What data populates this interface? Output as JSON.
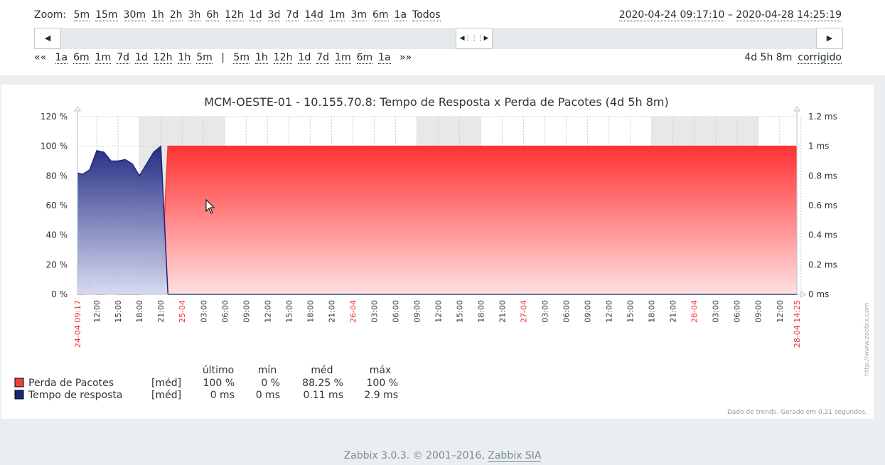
{
  "zoom": {
    "label": "Zoom:",
    "options": [
      "5m",
      "15m",
      "30m",
      "1h",
      "2h",
      "3h",
      "6h",
      "12h",
      "1d",
      "3d",
      "7d",
      "14d",
      "1m",
      "3m",
      "6m",
      "1a",
      "Todos"
    ]
  },
  "period": {
    "from": "2020-04-24 09:17:10",
    "separator": " – ",
    "to": "2020-04-28 14:25:19"
  },
  "scroll": {
    "left_icon": "triangle-left-icon",
    "right_icon": "triangle-right-icon",
    "thumb_icon": "drag-handle-icon",
    "left_glyph": "◀",
    "right_glyph": "▶",
    "thumb_glyph": "◀⋮⋮⋮▶"
  },
  "nav": {
    "back_all": "««",
    "back": [
      "1a",
      "6m",
      "1m",
      "7d",
      "1d",
      "12h",
      "1h",
      "5m"
    ],
    "separator": "|",
    "forward": [
      "5m",
      "1h",
      "12h",
      "1d",
      "7d",
      "1m",
      "6m",
      "1a"
    ],
    "forward_all": "»»"
  },
  "fixed": {
    "duration": "4d 5h 8m",
    "mode_link": "corrigido"
  },
  "graph": {
    "title": "MCM-OESTE-01 - 10.155.70.8: Tempo de Resposta x Perda de Pacotes (4d 5h 8m)",
    "left_ticks": [
      "120 %",
      "100 %",
      "80 %",
      "60 %",
      "40 %",
      "20 %",
      "0 %"
    ],
    "right_ticks": [
      "1.2 ms",
      "1 ms",
      "0.8 ms",
      "0.6 ms",
      "0.4 ms",
      "0.2 ms",
      "0 ms"
    ],
    "x_labels": [
      {
        "t": "24-04 09:17",
        "red": true
      },
      {
        "t": "12:00"
      },
      {
        "t": "15:00"
      },
      {
        "t": "18:00"
      },
      {
        "t": "21:00"
      },
      {
        "t": "25-04",
        "red": true
      },
      {
        "t": "03:00"
      },
      {
        "t": "06:00"
      },
      {
        "t": "09:00"
      },
      {
        "t": "12:00"
      },
      {
        "t": "15:00"
      },
      {
        "t": "18:00"
      },
      {
        "t": "21:00"
      },
      {
        "t": "26-04",
        "red": true
      },
      {
        "t": "03:00"
      },
      {
        "t": "06:00"
      },
      {
        "t": "09:00"
      },
      {
        "t": "12:00"
      },
      {
        "t": "15:00"
      },
      {
        "t": "18:00"
      },
      {
        "t": "21:00"
      },
      {
        "t": "27-04",
        "red": true
      },
      {
        "t": "03:00"
      },
      {
        "t": "06:00"
      },
      {
        "t": "09:00"
      },
      {
        "t": "12:00"
      },
      {
        "t": "15:00"
      },
      {
        "t": "18:00"
      },
      {
        "t": "21:00"
      },
      {
        "t": "28-04",
        "red": true
      },
      {
        "t": "03:00"
      },
      {
        "t": "06:00"
      },
      {
        "t": "09:00"
      },
      {
        "t": "12:00"
      },
      {
        "t": "28-04 14:25",
        "red": true
      }
    ],
    "watermark": "http://www.zabbix.com",
    "trend_note": "Dado de trends. Gerado em 0.21 segundos.",
    "legend_headers": [
      "último",
      "mín",
      "méd",
      "máx"
    ],
    "legend": [
      {
        "name": "Perda de Pacotes",
        "func": "[méd]",
        "last": "100 %",
        "min": "0 %",
        "avg": "88.25 %",
        "max": "100 %",
        "color": "#e8423f"
      },
      {
        "name": "Tempo de resposta",
        "func": "[méd]",
        "last": "0 ms",
        "min": "0 ms",
        "avg": "0.11 ms",
        "max": "2.9 ms",
        "color": "#1a237e"
      }
    ]
  },
  "chart_data": {
    "type": "area",
    "title": "MCM-OESTE-01 - 10.155.70.8: Tempo de Resposta x Perda de Pacotes (4d 5h 8m)",
    "ylim_left": [
      0,
      120
    ],
    "ylim_right": [
      0,
      1.2
    ],
    "series": [
      {
        "name": "Tempo de resposta",
        "axis": "right",
        "unit": "ms",
        "color": "#1a237e",
        "x": [
          "24-04 09:17",
          "24-04 10:00",
          "24-04 11:00",
          "24-04 12:00",
          "24-04 13:00",
          "24-04 14:00",
          "24-04 15:00",
          "24-04 16:00",
          "24-04 17:00",
          "24-04 18:00",
          "24-04 19:00",
          "24-04 20:00",
          "24-04 21:00",
          "24-04 22:00"
        ],
        "values": [
          0.82,
          0.81,
          0.84,
          0.97,
          0.96,
          0.9,
          0.9,
          0.91,
          0.88,
          0.8,
          0.88,
          0.96,
          1.0,
          0.0
        ]
      },
      {
        "name": "Perda de Pacotes",
        "axis": "left",
        "unit": "%",
        "color": "#ff3333",
        "x": [
          "24-04 09:17",
          "24-04 10:00",
          "24-04 11:00",
          "24-04 12:00",
          "24-04 13:00",
          "24-04 14:00",
          "24-04 15:00",
          "24-04 18:00",
          "24-04 21:00",
          "24-04 22:00",
          "28-04 14:25"
        ],
        "values": [
          0,
          0,
          9,
          0,
          0,
          3,
          0,
          0,
          2,
          100,
          100
        ]
      }
    ]
  },
  "footer": {
    "text": "Zabbix 3.0.3. © 2001–2016, ",
    "link": "Zabbix SIA"
  }
}
